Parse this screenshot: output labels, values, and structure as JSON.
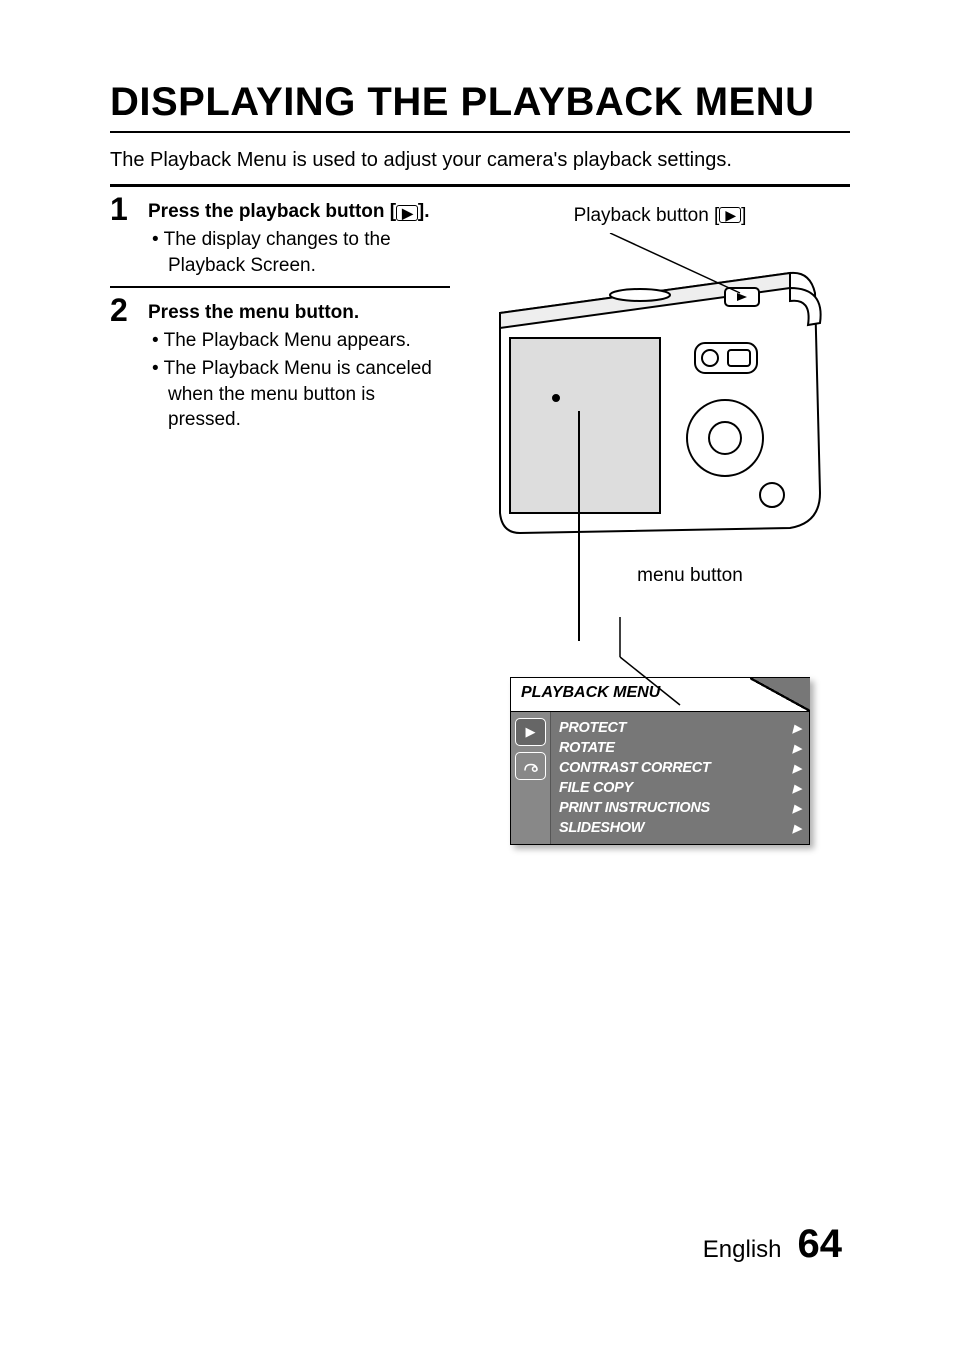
{
  "title": "DISPLAYING THE PLAYBACK MENU",
  "intro": "The Playback Menu is used to adjust your camera's playback settings.",
  "steps": [
    {
      "num": "1",
      "heading_pre": "Press the playback button [",
      "heading_post": "].",
      "bullets": [
        "The display changes to the Playback Screen."
      ]
    },
    {
      "num": "2",
      "heading": "Press the menu button.",
      "bullets": [
        "The Playback Menu appears.",
        "The Playback Menu is canceled when the menu button is pressed."
      ]
    }
  ],
  "labels": {
    "playback_button_pre": "Playback button [",
    "playback_button_post": "]",
    "menu_button": "menu button"
  },
  "menu": {
    "title": "PLAYBACK MENU",
    "items": [
      "PROTECT",
      "ROTATE",
      "CONTRAST CORRECT",
      "FILE COPY",
      "PRINT INSTRUCTIONS",
      "SLIDESHOW"
    ]
  },
  "footer": {
    "lang": "English",
    "page": "64"
  }
}
